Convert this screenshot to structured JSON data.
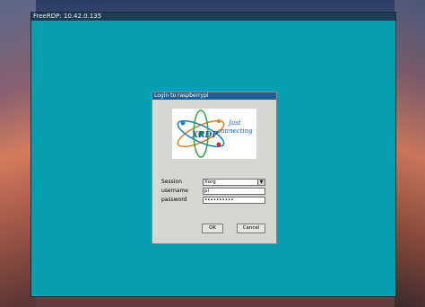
{
  "window": {
    "title": "FreeRDP: 10.42.0.135"
  },
  "dialog": {
    "title": "Login to raspberrypi",
    "logo": {
      "brand": "XRDP",
      "tagline_1": "Just",
      "tagline_2": "connecting"
    },
    "fields": {
      "session_label": "Session",
      "session_value": "Xorg",
      "username_label": "username",
      "username_value": "pi",
      "password_label": "password",
      "password_value": "••••••••••"
    },
    "buttons": {
      "ok": "OK",
      "cancel": "Cancel"
    }
  },
  "colors": {
    "desktop": "#079eb0",
    "titlebar": "#1f3b56",
    "dialog_title": "#1f5f92"
  }
}
